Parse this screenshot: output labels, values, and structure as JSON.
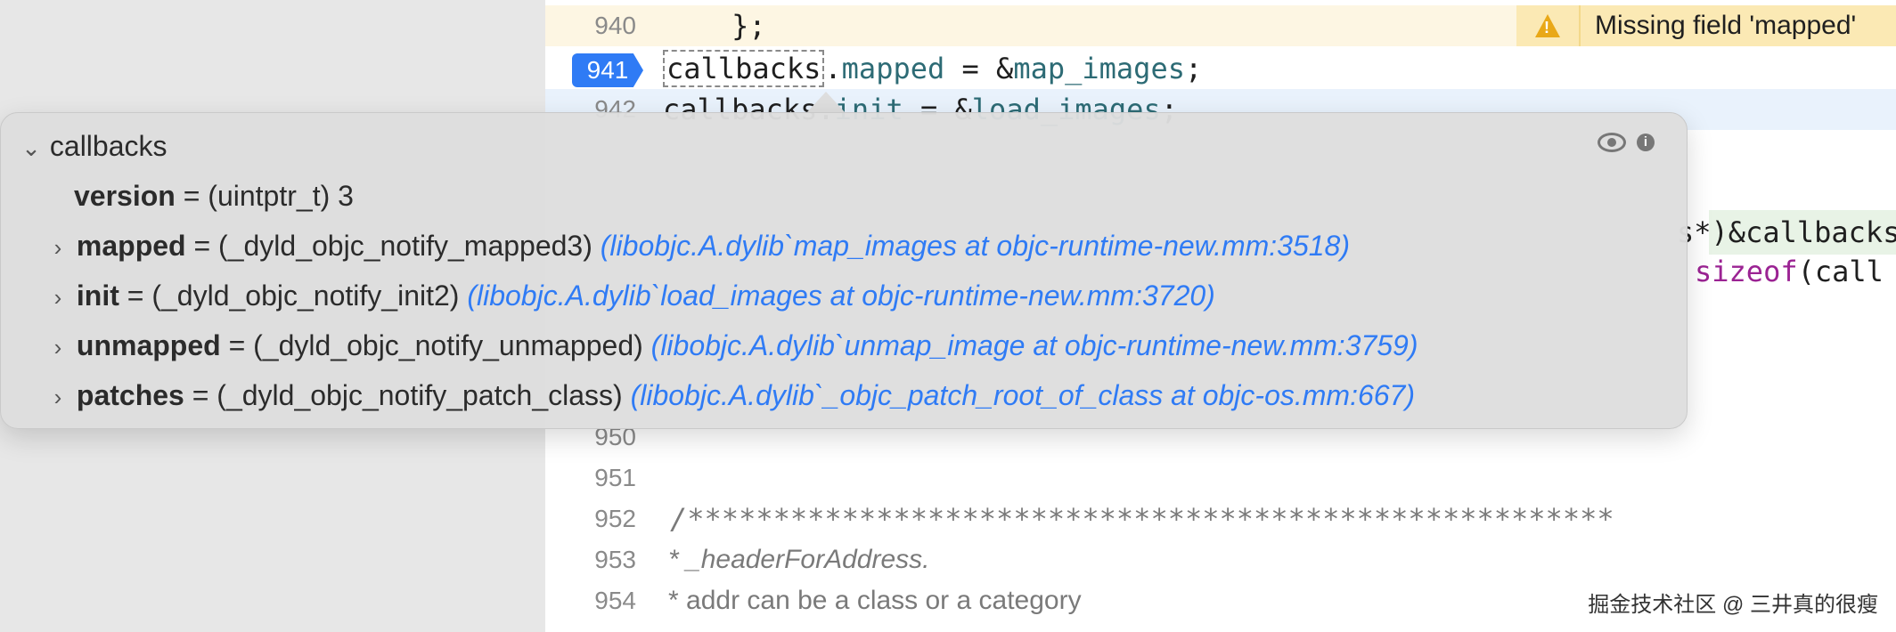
{
  "editor": {
    "lines": [
      {
        "num": "940",
        "code": "    };"
      },
      {
        "num": "941",
        "code_a": "callbacks",
        "code_b": ".",
        "code_c": "mapped",
        "code_d": " = &",
        "code_e": "map_images",
        "code_f": ";"
      },
      {
        "num": "942",
        "code_a": "callbacks",
        "code_b": ".",
        "code_c": "init",
        "code_d": " = &",
        "code_e": "load_images",
        "code_f": ";"
      },
      {
        "num": "950"
      },
      {
        "num": "951"
      },
      {
        "num": "952",
        "code": "/******************************************************"
      },
      {
        "num": "953",
        "code": "* _headerForAddress."
      },
      {
        "num": "954",
        "code": "* addr can be a class or a category"
      }
    ],
    "right_fragments": {
      "line_a": "s*)&callbacks",
      "line_b_kw": "sizeof",
      "line_b_rest": "(call"
    },
    "warning_text": "Missing field 'mapped'"
  },
  "popover": {
    "root_label": "callbacks",
    "rows": [
      {
        "name": "version",
        "value": " = (uintptr_t) 3",
        "link": ""
      },
      {
        "name": "mapped",
        "value": " = (_dyld_objc_notify_mapped3) ",
        "link": "(libobjc.A.dylib`map_images at objc-runtime-new.mm:3518)"
      },
      {
        "name": "init",
        "value": " = (_dyld_objc_notify_init2) ",
        "link": "(libobjc.A.dylib`load_images at objc-runtime-new.mm:3720)"
      },
      {
        "name": "unmapped",
        "value": " = (_dyld_objc_notify_unmapped) ",
        "link": "(libobjc.A.dylib`unmap_image at objc-runtime-new.mm:3759)"
      },
      {
        "name": "patches",
        "value": " = (_dyld_objc_notify_patch_class) ",
        "link": "(libobjc.A.dylib`_objc_patch_root_of_class at objc-os.mm:667)"
      }
    ],
    "info_glyph": "i"
  },
  "watermark": "掘金技术社区 @ 三井真的很瘦",
  "colors": {
    "accent": "#2f7bf5",
    "warning": "#fbe9b4",
    "link": "#2f7bf5"
  },
  "icons": [
    "warning-icon",
    "eye-icon",
    "info-icon",
    "chevron-down-icon",
    "chevron-right-icon"
  ]
}
